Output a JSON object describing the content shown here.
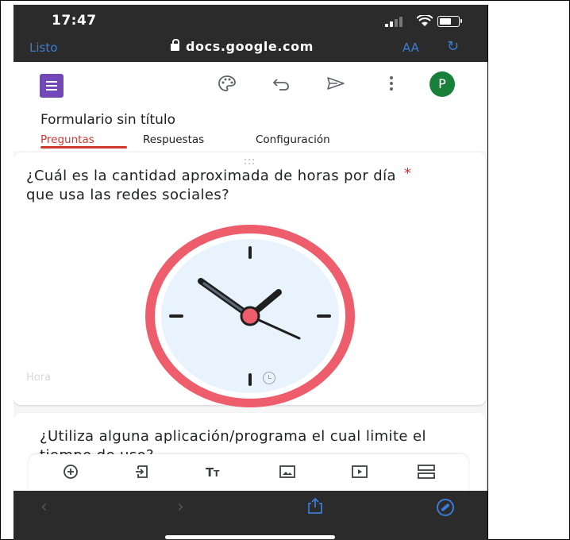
{
  "status": {
    "time": "17:47"
  },
  "browser": {
    "done_label": "Listo",
    "url": "docs.google.com",
    "text_size_label": "AA"
  },
  "form": {
    "title": "Formulario sin título",
    "avatar_letter": "P",
    "tabs": [
      {
        "label": "Preguntas",
        "active": true
      },
      {
        "label": "Respuestas",
        "active": false
      },
      {
        "label": "Configuración",
        "active": false
      }
    ],
    "questions": [
      {
        "text": "¿Cuál es la cantidad aproximada de horas por día que usa las redes sociales?",
        "required_mark": "*",
        "answer_placeholder": "Hora",
        "answer_icon": "clock-icon"
      },
      {
        "text": "¿Utiliza alguna aplicación/programa el cual limite el tiempo de uso?"
      }
    ]
  },
  "toolbar_icons": [
    "add-question-icon",
    "import-questions-icon",
    "add-title-icon",
    "add-image-icon",
    "add-video-icon",
    "add-section-icon"
  ],
  "colors": {
    "accent": "#d0372f",
    "forms_purple": "#7248b9",
    "browser_blue": "#3a7bd5",
    "avatar_green": "#188038",
    "clock_ring": "#ee5d6c"
  }
}
